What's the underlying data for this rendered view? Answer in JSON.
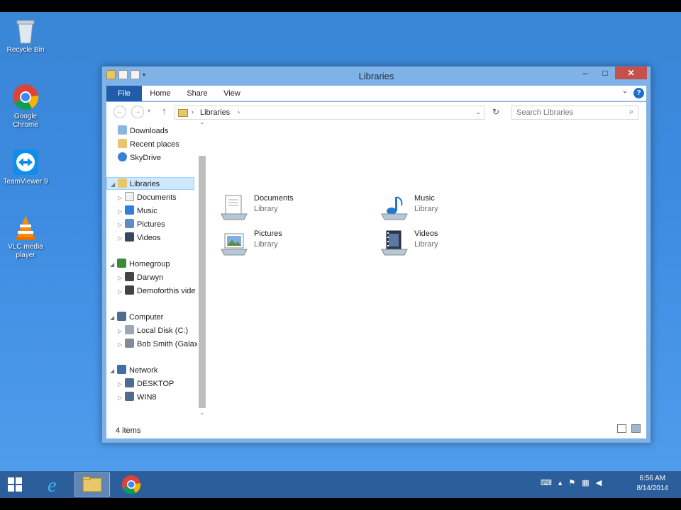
{
  "desktop": {
    "icons": [
      {
        "label": "Recycle Bin"
      },
      {
        "label": "Google Chrome"
      },
      {
        "label": "TeamViewer 9"
      },
      {
        "label": "VLC media player"
      }
    ]
  },
  "window": {
    "title": "Libraries",
    "ribbon_tabs": [
      "File",
      "Home",
      "Share",
      "View"
    ],
    "address": {
      "path": "Libraries"
    },
    "search": {
      "placeholder": "Search Libraries"
    },
    "nav": {
      "favorites": [
        "Downloads",
        "Recent places",
        "SkyDrive"
      ],
      "libraries_label": "Libraries",
      "libraries": [
        "Documents",
        "Music",
        "Pictures",
        "Videos"
      ],
      "homegroup_label": "Homegroup",
      "homegroup": [
        "Darwyn",
        "Demoforthis vide"
      ],
      "computer_label": "Computer",
      "computer": [
        "Local Disk (C:)",
        "Bob Smith (Galax"
      ],
      "network_label": "Network",
      "network": [
        "DESKTOP",
        "WIN8"
      ]
    },
    "items": [
      {
        "name": "Documents",
        "type": "Library",
        "icon": "documents-library-icon"
      },
      {
        "name": "Music",
        "type": "Library",
        "icon": "music-library-icon"
      },
      {
        "name": "Pictures",
        "type": "Library",
        "icon": "pictures-library-icon"
      },
      {
        "name": "Videos",
        "type": "Library",
        "icon": "videos-library-icon"
      }
    ],
    "status": {
      "count": "4 items"
    }
  },
  "taskbar": {
    "time": "6:56 AM",
    "date": "8/14/2014"
  },
  "colors": {
    "desktop_bg": "#3c8be0",
    "window_frame": "#7fb3e8",
    "file_tab": "#1f5dab",
    "close_button": "#c7504a",
    "selection": "#cde8ff",
    "taskbar": "#2b5e9a"
  }
}
